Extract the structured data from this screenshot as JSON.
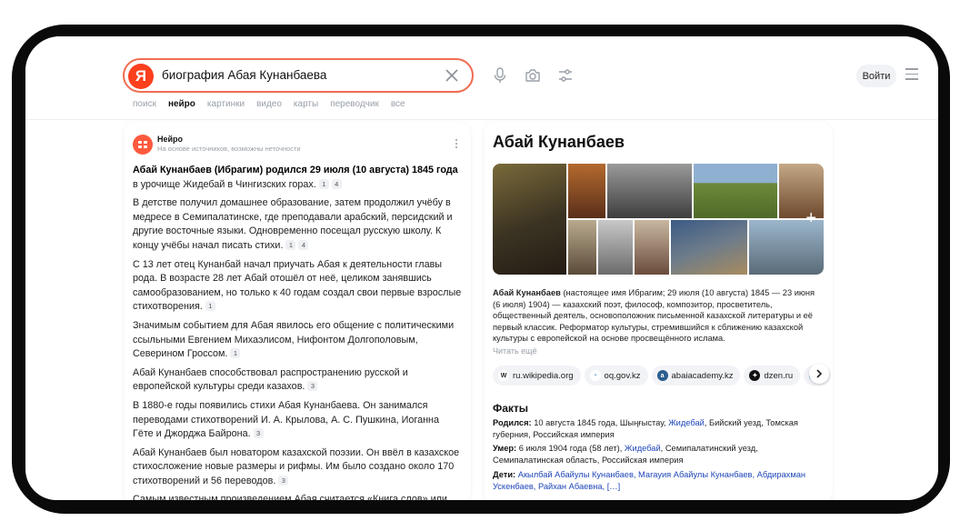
{
  "search": {
    "logo": "Я",
    "query": "биография Абая Кунанбаева"
  },
  "header": {
    "login_label": "Войти"
  },
  "tabs": [
    "поиск",
    "нейро",
    "картинки",
    "видео",
    "карты",
    "переводчик",
    "все"
  ],
  "active_tab_index": 1,
  "neuro": {
    "name": "Нейро",
    "subtitle": "На основе источников, возможны неточности",
    "paragraphs": [
      {
        "bold": "Абай Кунанбаев (Ибрагим) родился 29 июля (10 августа) 1845 года",
        "text": " в урочище Жидебай в Чингизских горах.",
        "refs": [
          "1",
          "4"
        ]
      },
      {
        "bold": "",
        "text": "В детстве получил домашнее образование, затем продолжил учёбу в медресе в Семипалатинске, где преподавали арабский, персидский и другие восточные языки. Одновременно посещал русскую школу. К концу учёбы начал писать стихи.",
        "refs": [
          "1",
          "4"
        ]
      },
      {
        "bold": "",
        "text": "С 13 лет отец Кунанбай начал приучать Абая к деятельности главы рода. В возрасте 28 лет Абай отошёл от неё, целиком занявшись самообразованием, но только к 40 годам создал свои первые взрослые стихотворения.",
        "refs": [
          "1"
        ]
      },
      {
        "bold": "",
        "text": "Значимым событием для Абая явилось его общение с политическими ссыльными Евгением Михаэлисом, Нифонтом Долгополовым, Северином Гроссом.",
        "refs": [
          "1"
        ]
      },
      {
        "bold": "",
        "text": "Абай Кунанбаев способствовал распространению русской и европейской культуры среди казахов.",
        "refs": [
          "3"
        ]
      },
      {
        "bold": "",
        "text": "В 1880-е годы появились стихи Абая Кунанбаева. Он занимался переводами стихотворений И. А. Крылова, А. С. Пушкина, Иоганна Гёте и Джорджа Байрона.",
        "refs": [
          "3"
        ]
      },
      {
        "bold": "",
        "text": "Абай Кунанбаев был новатором казахской поэзии. Он ввёл в казахское стихосложение новые размеры и рифмы. Им было создано около 170 стихотворений и 56 переводов.",
        "refs": [
          "3"
        ]
      },
      {
        "bold": "",
        "text": "Самым известным произведением Абая считается «Книга слов» или",
        "refs": []
      }
    ]
  },
  "entity": {
    "title": "Абай Кунанбаев",
    "description_bold": "Абай Кунанбаев",
    "description": " (настоящее имя Ибрагим; 29 июля (10 августа) 1845 — 23 июня (6 июля) 1904) — казахский поэт, философ, композитор, просветитель, общественный деятель, основоположник письменной казахской литературы и её первый классик. Реформатор культуры, стремившийся к сближению казахской культуры с европейской на основе просвещённого ислама.",
    "read_more": "Читать ещё",
    "sources": [
      {
        "label": "ru.wikipedia.org",
        "icon": "W",
        "color": "#ffffff",
        "fg": "#222222"
      },
      {
        "label": "oq.gov.kz",
        "icon": "◔",
        "color": "#ffffff",
        "fg": "#2f8bd6"
      },
      {
        "label": "abaiacademy.kz",
        "icon": "a",
        "color": "#2a5d8f",
        "fg": "#ffffff"
      },
      {
        "label": "dzen.ru",
        "icon": "✦",
        "color": "#111111",
        "fg": "#ffffff"
      }
    ],
    "facts_title": "Факты",
    "facts": [
      {
        "label": "Родился:",
        "pre": " 10 августа 1845 года, Шыңғыстау, ",
        "link": "Жидебай",
        "post": ", Бийский уезд, Томская губерния, Российская империя"
      },
      {
        "label": "Умер:",
        "pre": " 6 июля 1904 года (58 лет), ",
        "link": "Жидебай",
        "post": ", Семипалатинский уезд, Семипалатинская область, Российская империя"
      },
      {
        "label": "Дети:",
        "pre": " ",
        "link": "Акылбай Абайулы Кунанбаев, Магауия Абайулы Кунанбаев, Абдирахман Ускенбаев, Райхан Абаевна, […]",
        "post": ""
      }
    ]
  },
  "colors": {
    "brand": "#fc3f1d",
    "search_border": "#f06c52",
    "link": "#1f46b8"
  }
}
